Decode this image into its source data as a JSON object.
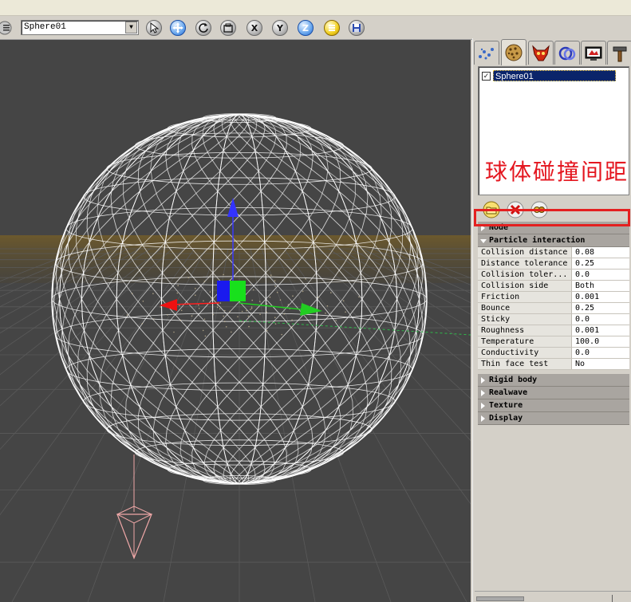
{
  "toolbar": {
    "object_name": "Sphere01",
    "axis_x_label": "X",
    "axis_y_label": "Y",
    "axis_z_label": "Z",
    "active_axis": "Z",
    "icons": [
      "menu-icon",
      "cursor-select-icon",
      "move-icon",
      "rotate-icon",
      "scale-icon",
      "axis-x-icon",
      "axis-y-icon",
      "axis-z-icon",
      "list-icon",
      "save-icon"
    ]
  },
  "tabs": {
    "icons": [
      "particles-tab-icon",
      "objects-tab-icon",
      "daemons-tab-icon",
      "interaction-tab-icon",
      "render-tab-icon",
      "tools-tab-icon"
    ],
    "active_index": 1
  },
  "object_list": {
    "items": [
      {
        "label": "Sphere01",
        "checked": true,
        "check_mark": "✓"
      }
    ]
  },
  "annotation": {
    "text": "球体碰撞间距",
    "color": "#e4161f"
  },
  "list_actions": {
    "icons": [
      "add-object-icon",
      "delete-object-icon",
      "link-object-icon"
    ]
  },
  "properties": {
    "sections_top": [
      {
        "label": "Node",
        "open": false
      },
      {
        "label": "Particle interaction",
        "open": true
      }
    ],
    "rows": [
      {
        "name": "Collision distance",
        "value": "0.08"
      },
      {
        "name": "Distance tolerance",
        "value": "0.25"
      },
      {
        "name": "Collision toler...",
        "value": "0.0"
      },
      {
        "name": "Collision side",
        "value": "Both"
      },
      {
        "name": "Friction",
        "value": "0.001"
      },
      {
        "name": "Bounce",
        "value": "0.25"
      },
      {
        "name": "Sticky",
        "value": "0.0"
      },
      {
        "name": "Roughness",
        "value": "0.001"
      },
      {
        "name": "Temperature",
        "value": "100.0"
      },
      {
        "name": "Conductivity",
        "value": "0.0"
      },
      {
        "name": "Thin face test",
        "value": "No"
      }
    ],
    "sections_bottom": [
      {
        "label": "Rigid body",
        "open": false
      },
      {
        "label": "Realwave",
        "open": false
      },
      {
        "label": "Texture",
        "open": false
      },
      {
        "label": "Display",
        "open": false
      }
    ]
  },
  "colors": {
    "viewport_bg": "#444444",
    "grid_line": "#5a5a5a",
    "ground_glow": "#8a6a2a",
    "wire": "#ffffff",
    "highlight": "#e42020",
    "selection": "#0a246a"
  }
}
